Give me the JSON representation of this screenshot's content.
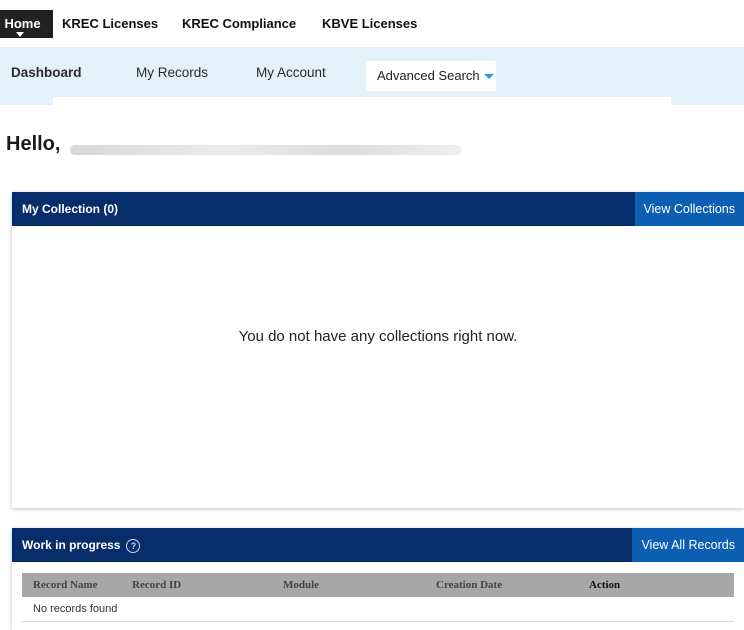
{
  "top_nav": {
    "items": [
      "Home",
      "KREC Licenses",
      "KREC Compliance",
      "KBVE Licenses"
    ],
    "active": "Home"
  },
  "sub_nav": {
    "tabs": [
      "Dashboard",
      "My Records",
      "My Account"
    ],
    "active": "Dashboard",
    "advanced_search": "Advanced Search"
  },
  "greeting": "Hello,",
  "collection_panel": {
    "title": "My Collection (0)",
    "button": "View Collections",
    "empty_message": "You do not have any collections right now."
  },
  "wip_panel": {
    "title": "Work in progress",
    "help_icon": "?",
    "button": "View All Records",
    "columns": [
      "Record Name",
      "Record ID",
      "Module",
      "Creation Date",
      "Action"
    ],
    "empty_row": "No records found"
  },
  "colors": {
    "panel_header": "#082d6b",
    "panel_button": "#0c5fb3",
    "subnav_bg": "#e3f1fb",
    "accent": "#2b9be0"
  }
}
